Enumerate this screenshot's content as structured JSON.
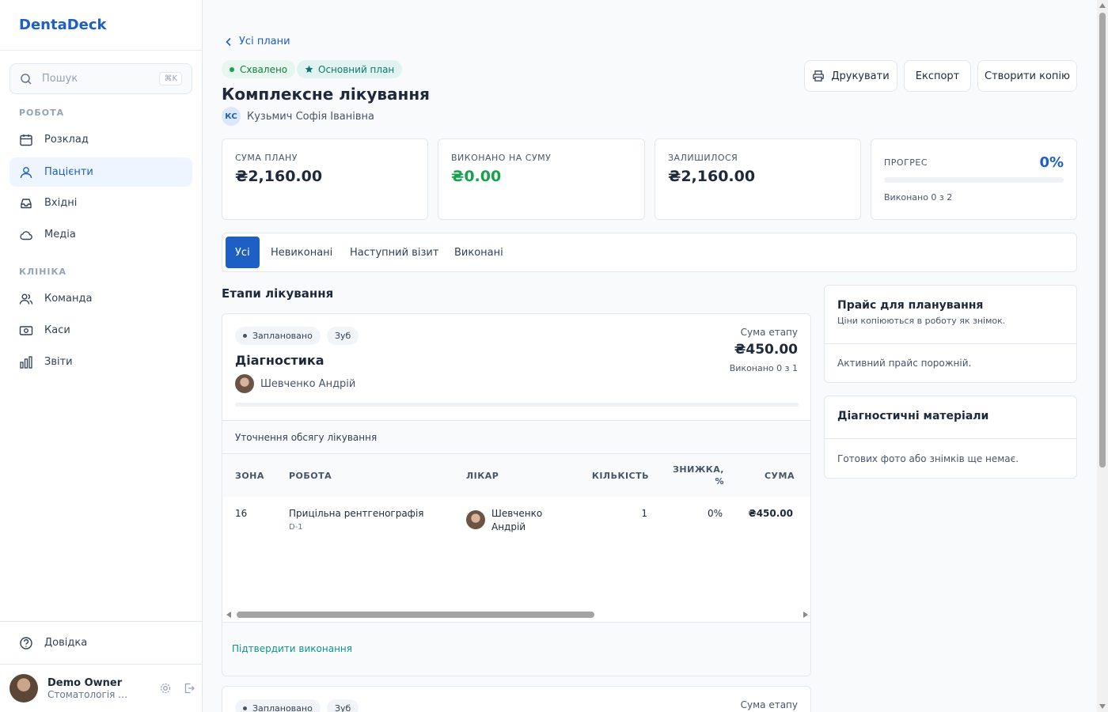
{
  "sidebar": {
    "brand": "DentaDeck",
    "search": {
      "placeholder": "Пошук",
      "shortcut": "⌘K"
    },
    "sections": [
      {
        "label": "РОБОТА"
      },
      {
        "label": "КЛІНІКА"
      }
    ],
    "items": [
      {
        "label": "Розклад",
        "icon": "calendar-icon"
      },
      {
        "label": "Пацієнти",
        "icon": "users-icon",
        "active": true
      },
      {
        "label": "Вхідні",
        "icon": "inbox-icon"
      },
      {
        "label": "Медіа",
        "icon": "cloud-icon"
      },
      {
        "label": "Команда",
        "icon": "team-icon"
      },
      {
        "label": "Каси",
        "icon": "cash-icon"
      },
      {
        "label": "Звіти",
        "icon": "chart-icon"
      }
    ],
    "help": "Довідка",
    "user": {
      "name": "Demo Owner",
      "role": "Стоматологія П..."
    }
  },
  "header": {
    "back": "Усі плани",
    "badges": {
      "status": "Схвалено",
      "main_plan": "Основний план"
    },
    "title": "Комплексне лікування",
    "patient": {
      "initials": "КС",
      "name": "Кузьмич Софія Іванівна"
    },
    "actions": {
      "print": "Друкувати",
      "export": "Експорт",
      "copy": "Створити копію"
    }
  },
  "stats": {
    "plan_sum": {
      "label": "СУМА ПЛАНУ",
      "value": "₴2,160.00"
    },
    "done_sum": {
      "label": "ВИКОНАНО НА СУМУ",
      "value": "₴0.00"
    },
    "remaining": {
      "label": "ЗАЛИШИЛОСЯ",
      "value": "₴2,160.00"
    },
    "progress": {
      "label": "ПРОГРЕС",
      "value": "0%",
      "fraction": 0,
      "sub": "Виконано 0 з 2"
    }
  },
  "tabs": [
    "Усі",
    "Невиконані",
    "Наступний візит",
    "Виконані"
  ],
  "stages_title": "Етапи лікування",
  "stages": [
    {
      "status": "Заплановано",
      "tag": "Зуб",
      "name": "Діагностика",
      "doctor": "Шевченко Андрій",
      "sum_label": "Сума етапу",
      "sum": "₴450.00",
      "count": "Виконано 0 з 1",
      "progress": 0,
      "note": "Уточнення обсягу лікування",
      "table": {
        "headers": [
          "ЗОНА",
          "РОБОТА",
          "ЛІКАР",
          "КІЛЬКІСТЬ",
          "ЗНИЖКА,",
          "%",
          "СУМА"
        ],
        "rows": [
          {
            "zone": "16",
            "work": "Прицільна рентгенографія",
            "code": "D-1",
            "doctor_first": "Шевченко",
            "doctor_last": "Андрій",
            "qty": "1",
            "discount": "0%",
            "sum": "₴450.00"
          }
        ]
      },
      "confirm": "Підтвердити виконання"
    },
    {
      "status": "Заплановано",
      "tag": "Зуб",
      "sum_label": "Сума етапу"
    }
  ],
  "side": {
    "pricing": {
      "title": "Прайс для планування",
      "sub": "Ціни копіюються в роботу як знімок.",
      "body": "Активний прайс порожній."
    },
    "diagnostics": {
      "title": "Діагностичні матеріали",
      "body": "Готових фото або знімків ще немає."
    }
  },
  "colors": {
    "accent": "#1d5fc4",
    "success": "#16a34a",
    "teal": "#0d9488"
  }
}
